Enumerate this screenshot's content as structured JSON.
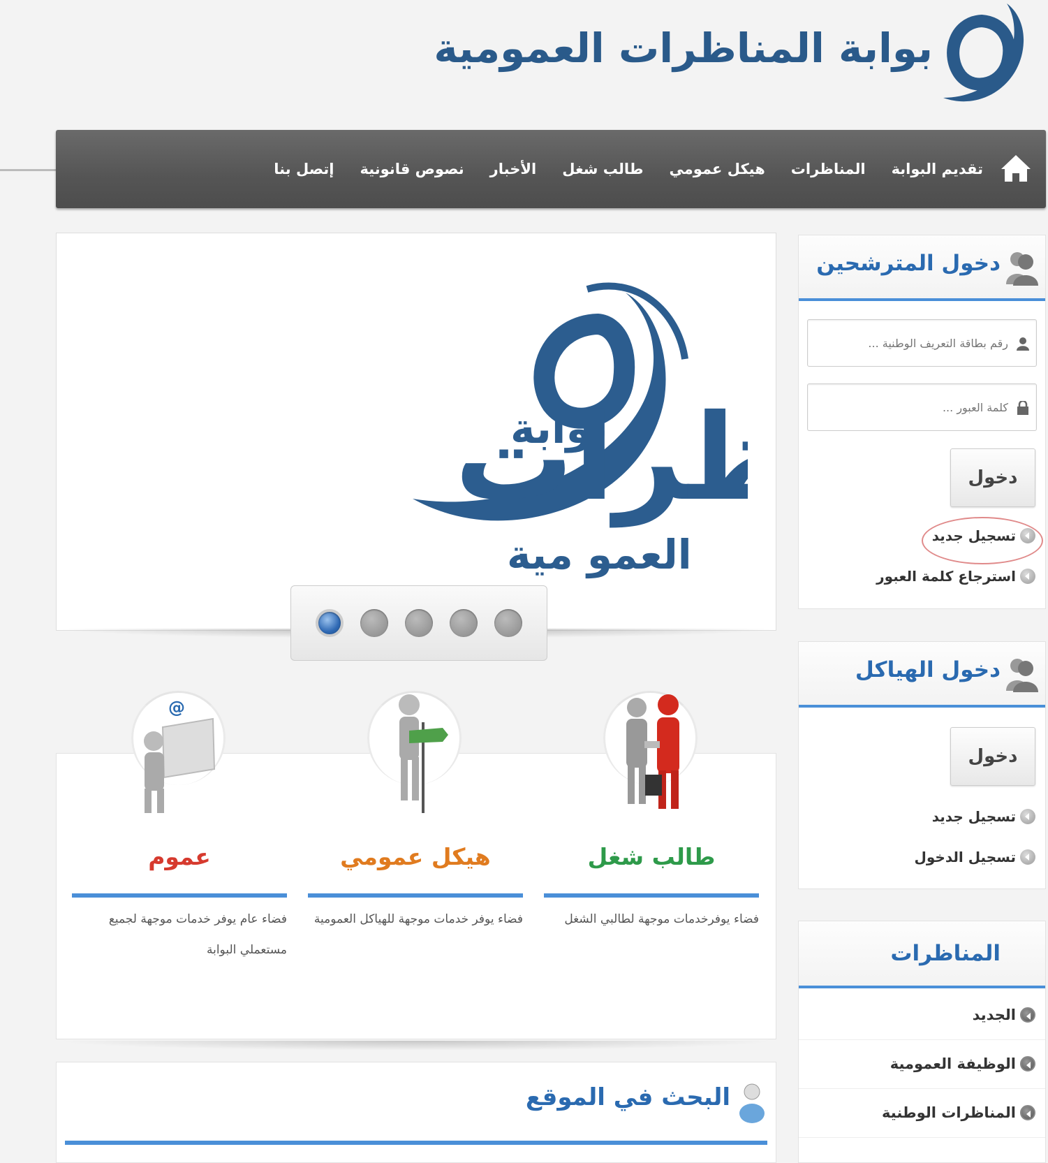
{
  "header": {
    "site_title": "بوابة المناظرات العمومية"
  },
  "nav": {
    "home_icon": "home-icon",
    "items": [
      "تقديم البوابة",
      "المناظرات",
      "هيكل عمومي",
      "طالب شغل",
      "الأخبار",
      "نصوص قانونية",
      "إتصل بنا"
    ]
  },
  "slider": {
    "logo_word_top": "بوابة",
    "logo_word_main": "مناظرات",
    "logo_word_bottom": "العمو مية",
    "dots": 5,
    "active_dot": 5
  },
  "features": [
    {
      "title": "طالب شغل",
      "color": "#2e9a4a",
      "description": "فضاء يوفرخدمات موجهة لطالبي الشغل"
    },
    {
      "title": "هيكل عمومي",
      "color": "#e07b1f",
      "description": "فضاء يوفر خدمات موجهة للهياكل العمومية"
    },
    {
      "title": "عموم",
      "color": "#d63a2e",
      "description": "فضاء عام يوفر خدمات موجهة لجميع مستعملي البوابة"
    }
  ],
  "search": {
    "title": "البحث في الموقع"
  },
  "candidates_login": {
    "title": "دخول المترشحين",
    "id_placeholder": "رقم بطاقة التعريف الوطنية ...",
    "password_placeholder": "كلمة العبور ...",
    "login_label": "دخول",
    "register_label": "تسجيل جديد",
    "recover_label": "استرجاع كلمة العبور"
  },
  "structures_login": {
    "title": "دخول الهياكل",
    "login_label": "دخول",
    "register_label": "تسجيل جديد",
    "signin_label": "تسجيل الدخول"
  },
  "competitions": {
    "title": "المناظرات",
    "items": [
      "الجديد",
      "الوظيفة العمومية",
      "المناظرات الوطنية"
    ]
  },
  "colors": {
    "accent": "#4a8fd8",
    "title_blue": "#2a6ab0",
    "nav_bg": "#5a5a5a"
  }
}
